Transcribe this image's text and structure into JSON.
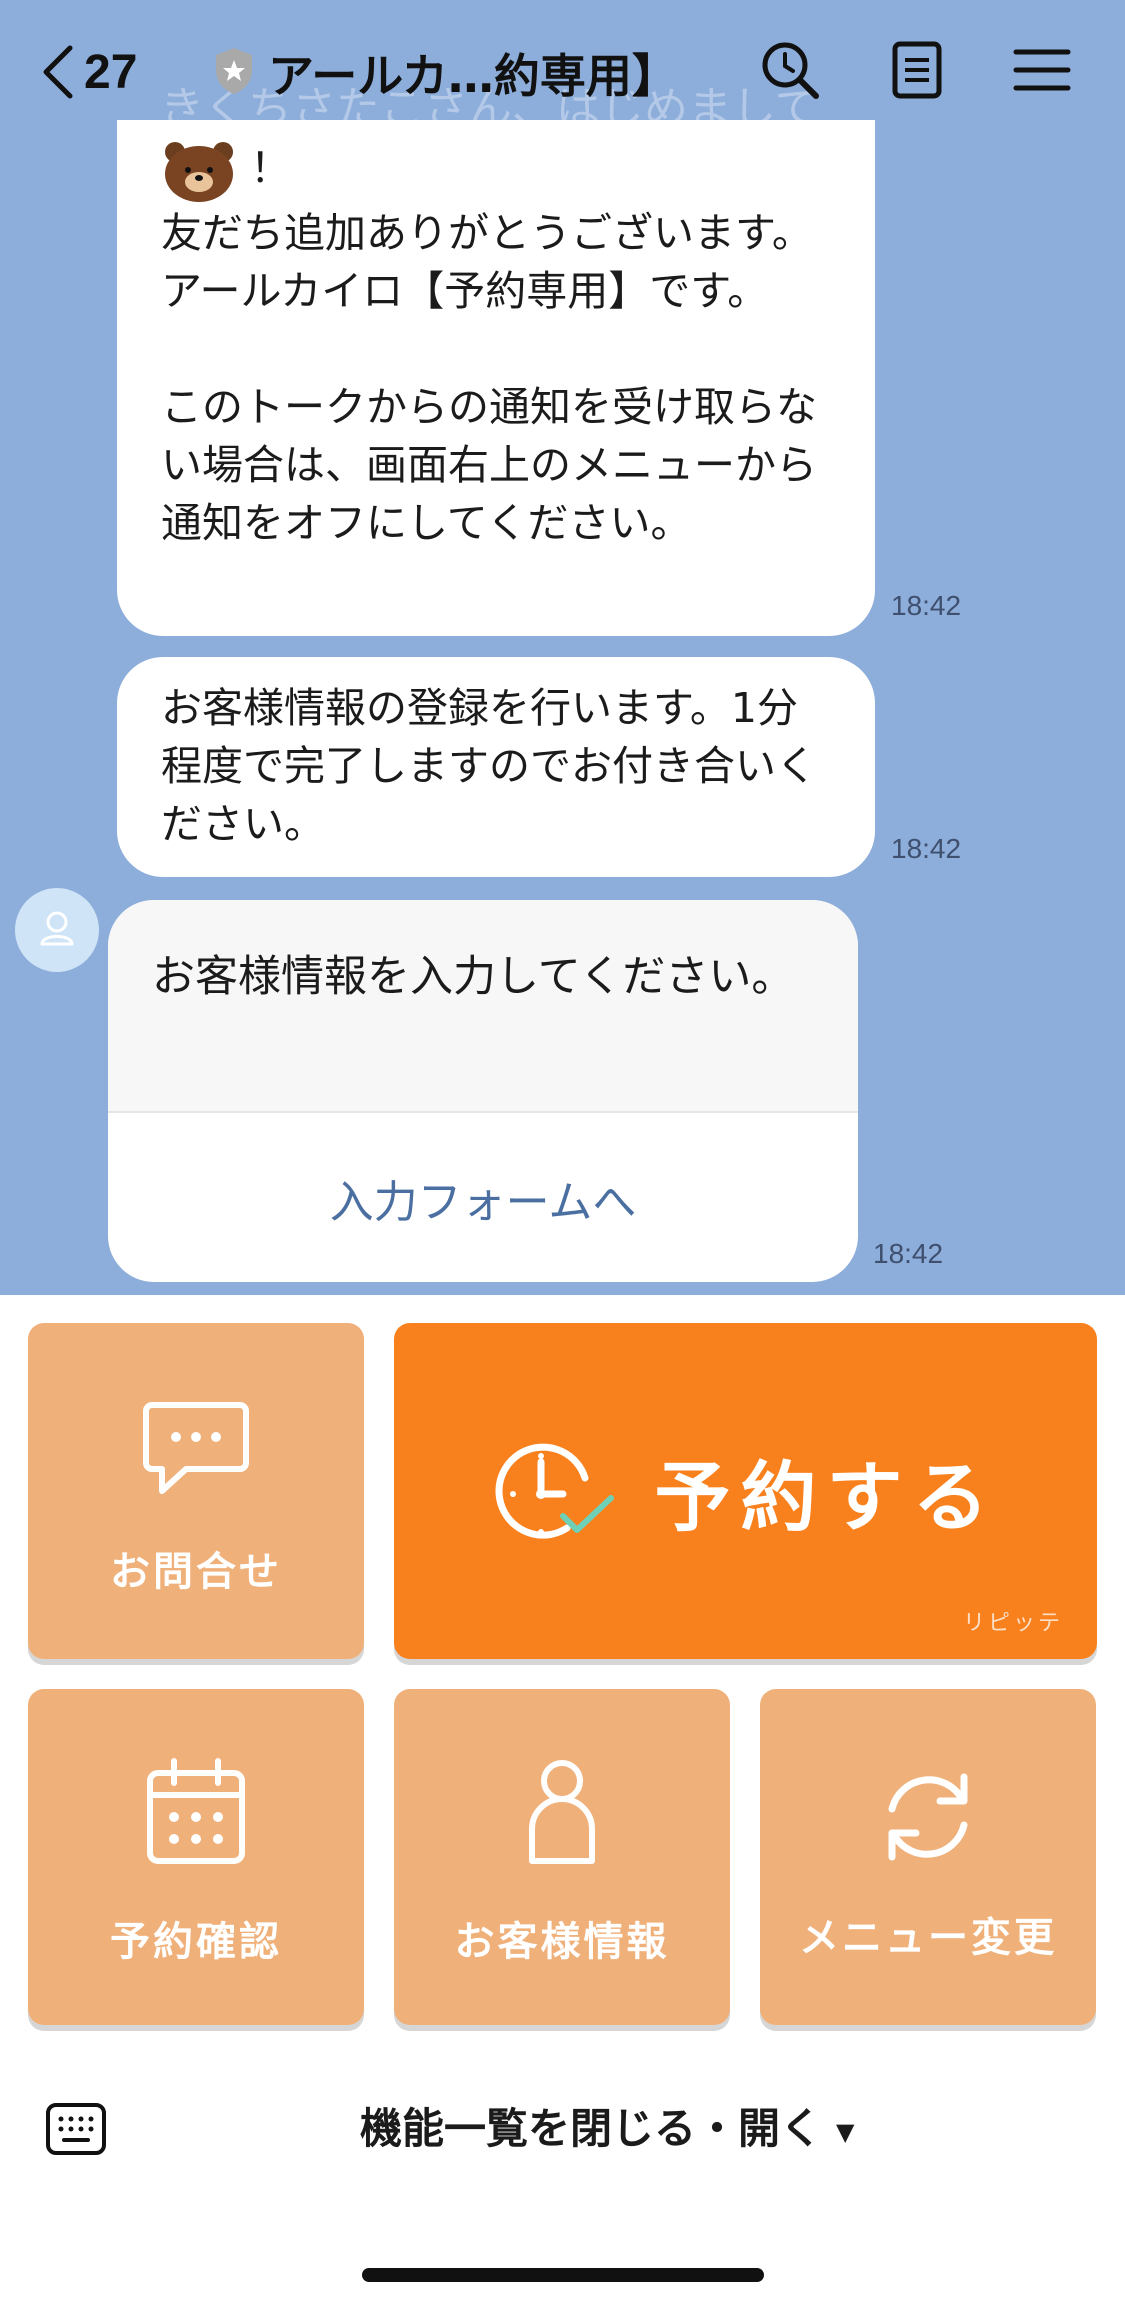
{
  "header": {
    "back_count": "27",
    "title": "アールカ…約専用】",
    "ghost_text": "きくちさたこさん、はじめまして"
  },
  "messages": [
    {
      "text": "！\n友だち追加ありがとうございます。アールカイロ【予約専用】です。\n\nこのトークからの通知を受け取らない場合は、画面右上のメニューから通知をオフにしてください。",
      "time": "18:42"
    },
    {
      "text": "お客様情報の登録を行います。1分程度で完了しますのでお付き合いください。",
      "time": "18:42"
    },
    {
      "text": "お客様情報を入力してください。",
      "button": "入力フォームへ",
      "time": "18:42"
    }
  ],
  "rich_menu": {
    "contact": "お問合せ",
    "reserve": "予約する",
    "reserve_brand": "リピッテ",
    "check": "予約確認",
    "customer": "お客様情報",
    "change": "メニュー変更"
  },
  "bottom_bar": {
    "toggle_label": "機能一覧を閉じる・開く",
    "toggle_arrow": "▼"
  },
  "colors": {
    "chat_bg": "#8dadda",
    "tile": "#efb07a",
    "tile_primary": "#f8811e",
    "link": "#4a6fa0"
  },
  "icons": [
    "back-chevron-icon",
    "shield-icon",
    "search-icon",
    "notes-icon",
    "menu-icon",
    "bear-sticker-icon",
    "user-avatar-icon",
    "chat-bubble-icon",
    "clock-check-icon",
    "calendar-icon",
    "person-icon",
    "refresh-icon",
    "keyboard-icon"
  ]
}
